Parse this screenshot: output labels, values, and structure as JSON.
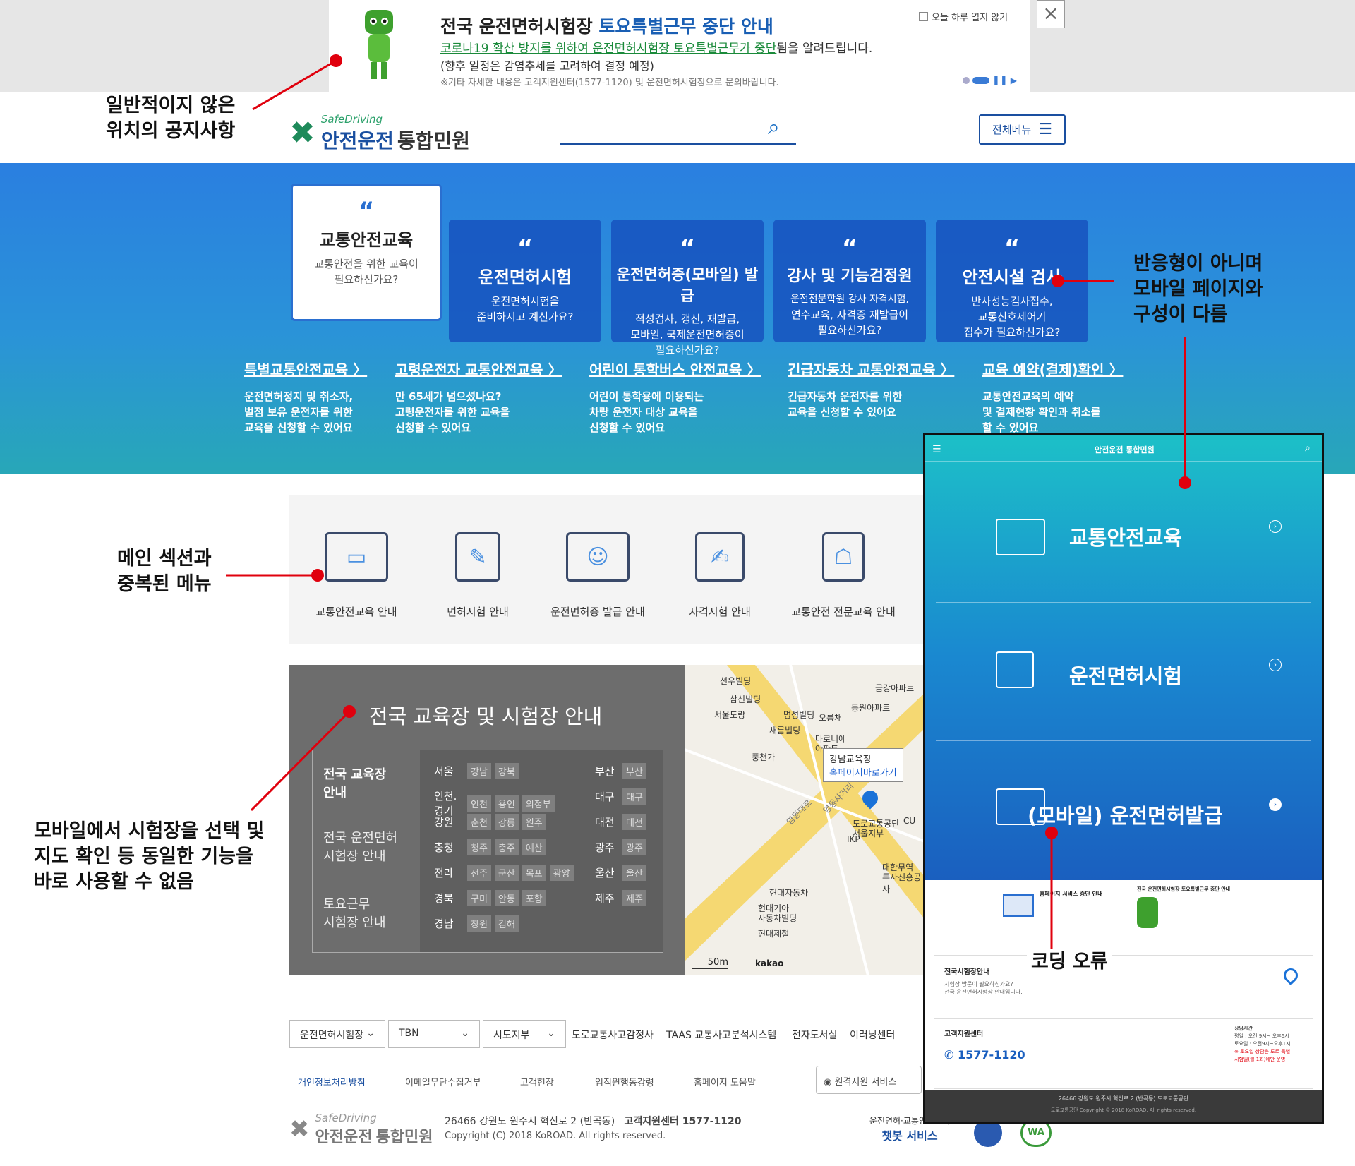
{
  "popup": {
    "title_a": "전국 운전면허시험장 ",
    "title_b": "토요특별근무 중단 안내",
    "line1_u": "코로나19 확산 방지를 위하여 운전면허시험장 토요특별근무가 중단",
    "line1_rest": "됨을 알려드립니다.",
    "line2": "(향후 일정은 감염추세를 고려하여 결정 예정)",
    "line3": "※기타 자세한 내용은 고객지원센터(1577-1120) 및 운전면허시험장으로 문의바랍니다.",
    "no_show_today": "오늘 하루 열지 않기",
    "close": "×"
  },
  "header": {
    "logo_small": "SafeDriving",
    "logo_main": "안전운전",
    "logo_sub": "통합민원",
    "full_menu": "전체메뉴"
  },
  "cards": [
    {
      "title": "교통안전교육",
      "desc1": "교통안전을 위한 교육이",
      "desc2": "필요하신가요?",
      "desc3": ""
    },
    {
      "title": "운전면허시험",
      "desc1": "운전면허시험을",
      "desc2": "준비하시고 계신가요?",
      "desc3": ""
    },
    {
      "title": "운전면허증(모바일) 발급",
      "desc1": "적성검사, 갱신, 재발급,",
      "desc2": "모바일, 국제운전면허증이",
      "desc3": "필요하신가요?"
    },
    {
      "title": "강사 및 기능검정원",
      "desc1": "운전전문학원 강사 자격시험,",
      "desc2": "연수교육, 자격증 재발급이",
      "desc3": "필요하신가요?"
    },
    {
      "title": "안전시설 검사",
      "desc1": "반사성능검사접수,",
      "desc2": "교통신호제어기",
      "desc3": "접수가 필요하신가요?"
    }
  ],
  "sub_links": [
    {
      "title": "특별교통안전교육 〉",
      "l1": "운전면허정지 및 취소자,",
      "l2": "벌점 보유 운전자를 위한",
      "l3": "교육을 신청할 수 있어요"
    },
    {
      "title": "고령운전자 교통안전교육 〉",
      "l1": "만 65세가 넘으셨나요?",
      "l2": "고령운전자를 위한 교육을",
      "l3": "신청할 수 있어요"
    },
    {
      "title": "어린이 통학버스 안전교육 〉",
      "l1": "어린이 통학용에 이용되는",
      "l2": "차량 운전자 대상 교육을",
      "l3": "신청할 수 있어요"
    },
    {
      "title": "긴급자동차 교통안전교육 〉",
      "l1": "긴급자동차 운전자를 위한",
      "l2": "교육을 신청할 수 있어요",
      "l3": ""
    },
    {
      "title": "교육 예약(결제)확인 〉",
      "l1": "교통안전교육의 예약",
      "l2": "및 결제현황 확인과 취소를",
      "l3": "할 수 있어요"
    }
  ],
  "quick_menu": [
    "교통안전교육 안내",
    "면허시험 안내",
    "운전면허증 발급 안내",
    "자격시험 안내",
    "교통안전 전문교육 안내"
  ],
  "centers": {
    "title": "전국 교육장 및 시험장 안내",
    "left1": "전국 교육장",
    "left1b": "안내",
    "left2a": "전국 운전면허",
    "left2b": "시험장 안내",
    "left3a": "토요근무",
    "left3b": "시험장 안내",
    "rows_l": [
      {
        "region": "서울",
        "chips": [
          "강남",
          "강북"
        ]
      },
      {
        "region": "인천.경기",
        "chips": [
          "인천",
          "용인",
          "의정부"
        ]
      },
      {
        "region": "강원",
        "chips": [
          "춘천",
          "강릉",
          "원주"
        ]
      },
      {
        "region": "충청",
        "chips": [
          "청주",
          "충주",
          "예산"
        ]
      },
      {
        "region": "전라",
        "chips": [
          "전주",
          "군산",
          "목포",
          "광양"
        ]
      },
      {
        "region": "경북",
        "chips": [
          "구미",
          "안동",
          "포항"
        ]
      },
      {
        "region": "경남",
        "chips": [
          "창원",
          "김해"
        ]
      }
    ],
    "rows_r": [
      {
        "region": "부산",
        "chips": [
          "부산"
        ]
      },
      {
        "region": "대구",
        "chips": [
          "대구"
        ]
      },
      {
        "region": "대전",
        "chips": [
          "대전"
        ]
      },
      {
        "region": "광주",
        "chips": [
          "광주"
        ]
      },
      {
        "region": "울산",
        "chips": [
          "울산"
        ]
      },
      {
        "region": "제주",
        "chips": [
          "제주"
        ]
      }
    ]
  },
  "map": {
    "popup_title": "강남교육장",
    "popup_link": "홈페이지바로가기",
    "scale": "50m",
    "brand": "kakao",
    "labels": [
      "선우빌딩",
      "삼신빌딩",
      "서울도랑",
      "명성빌딩",
      "오름채",
      "새롬빌딩",
      "마로니에",
      "아파트",
      "풍천가",
      "금강아파트",
      "동원아파트",
      "현대자동차",
      "현대기아",
      "자동차빌딩",
      "현대제철",
      "대한무역",
      "투자진흥공사",
      "IKP",
      "CU",
      "도로교통공단",
      "서울지부",
      "영동대로",
      "영동사거리"
    ]
  },
  "footer": {
    "sel1": "운전면허시험장",
    "sel2": "TBN",
    "sel3": "시도지부",
    "links": [
      "도로교통사고감정사",
      "TAAS 교통사고분석시스템",
      "전자도서실",
      "이러닝센터"
    ],
    "links2": [
      "개인정보처리방침",
      "이메일무단수집거부",
      "고객헌장",
      "임직원행동강령",
      "홈페이지 도움말"
    ],
    "remote": "원격지원 서비스",
    "address": "26466 강원도 원주시 혁신로 2 (반곡동)",
    "callcenter": "고객지원센터 1577-1120",
    "copyright": "Copyright (C) 2018 KoROAD. All rights reserved.",
    "chatbot1": "운전면허·교통안전교육",
    "chatbot2": "챗봇 서비스",
    "wa": "WA"
  },
  "mobile": {
    "logo": "안전운전 통합민원",
    "items": [
      "교통안전교육",
      "운전면허시험",
      "(모바일) 운전면허발급"
    ],
    "notice1_title": "홈페이지 서비스 중단 안내",
    "notice2_title": "전국 운전면허시험장 토요특별근무 중단 안내",
    "card1_title": "전국시험장안내",
    "card1_l1": "시험장 방문이 필요하신가요?",
    "card1_l2": "전국 운전면허시험장 안내입니다.",
    "card2_title": "고객지원센터",
    "card2_phone": "1577-1120",
    "hours_title": "상담시간",
    "hours_1": "평일 : 오전 9시~ 오후6시",
    "hours_2": "토요일 : 오전9시~오후1시",
    "hours_3": "※ 토요일 상담은 도로 특별",
    "hours_4": "시험일(월 1회)에만 운영",
    "foot_addr": "26466 강원도 원주시 혁신로 2 (반곡동) 도로교통공단",
    "foot_copy": "도로교통공단  Copyright © 2018 KoROAD. All rights reserved."
  },
  "annotations": {
    "a1_1": "일반적이지 않은",
    "a1_2": "위치의 공지사항",
    "a2_1": "반응형이 아니며",
    "a2_2": "모바일 페이지와",
    "a2_3": "구성이 다름",
    "a3_1": "메인 섹션과",
    "a3_2": "중복된 메뉴",
    "a4_1": "모바일에서 시험장을 선택 및",
    "a4_2": "지도 확인 등 동일한 기능을",
    "a4_3": "바로 사용할 수 없음",
    "a5": "코딩 오류"
  },
  "colors": {
    "accent_blue": "#1a4fa0",
    "band_top": "#2a7fe0",
    "annotation_red": "#e0000d",
    "brand_green": "#1e8a5a"
  }
}
